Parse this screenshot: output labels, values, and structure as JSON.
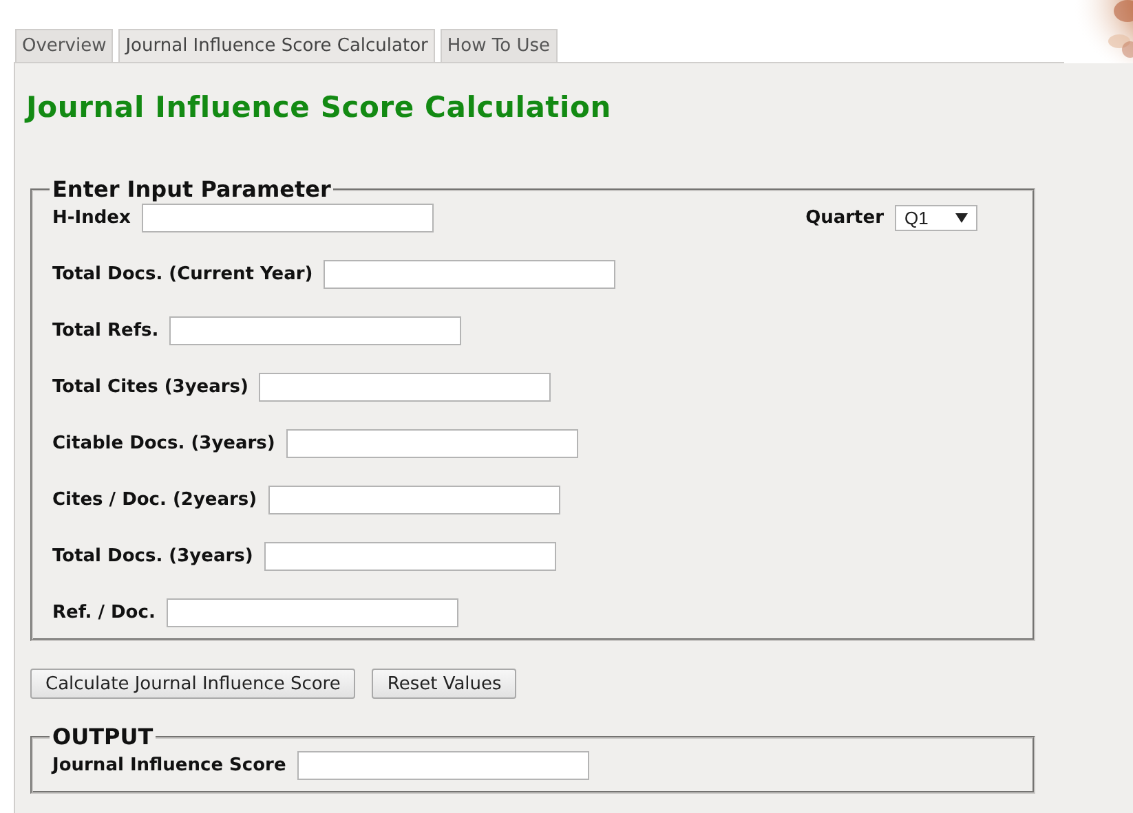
{
  "tabs": [
    {
      "label": "Overview",
      "selected": false
    },
    {
      "label": "Journal Influence Score Calculator",
      "selected": true
    },
    {
      "label": "How To Use",
      "selected": false
    }
  ],
  "title": "Journal Influence Score Calculation",
  "input_section": {
    "legend": "Enter Input Parameter",
    "quarter": {
      "label": "Quarter",
      "value": "Q1"
    },
    "fields": [
      {
        "label": "H-Index"
      },
      {
        "label": "Total Docs. (Current Year)"
      },
      {
        "label": "Total Refs."
      },
      {
        "label": "Total Cites (3years)"
      },
      {
        "label": "Citable Docs. (3years)"
      },
      {
        "label": "Cites / Doc. (2years)"
      },
      {
        "label": "Total Docs. (3years)"
      },
      {
        "label": "Ref. / Doc."
      }
    ]
  },
  "buttons": [
    "Calculate Journal Influence Score",
    "Reset Values"
  ],
  "output_section": {
    "legend": "OUTPUT",
    "fields": [
      {
        "label": "Journal Influence Score"
      }
    ]
  }
}
